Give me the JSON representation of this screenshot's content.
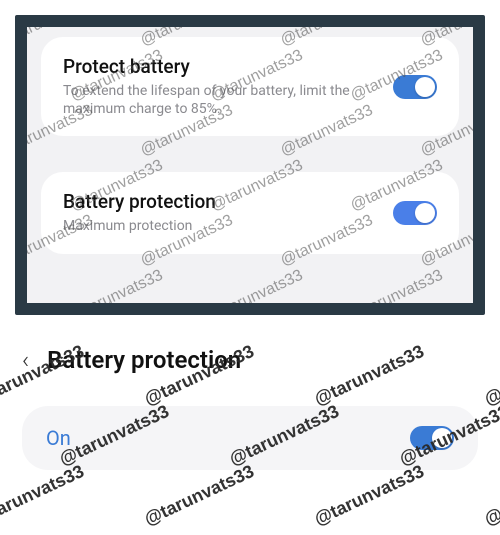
{
  "watermark": "@tarunvats33",
  "top": {
    "card1": {
      "title": "Protect battery",
      "description": "To extend the lifespan of your battery, limit the maximum charge to 85%."
    },
    "card2": {
      "title": "Battery protection",
      "subtitle": "Maximum protection"
    }
  },
  "bottom": {
    "header": "Battery protection",
    "status": "On"
  }
}
